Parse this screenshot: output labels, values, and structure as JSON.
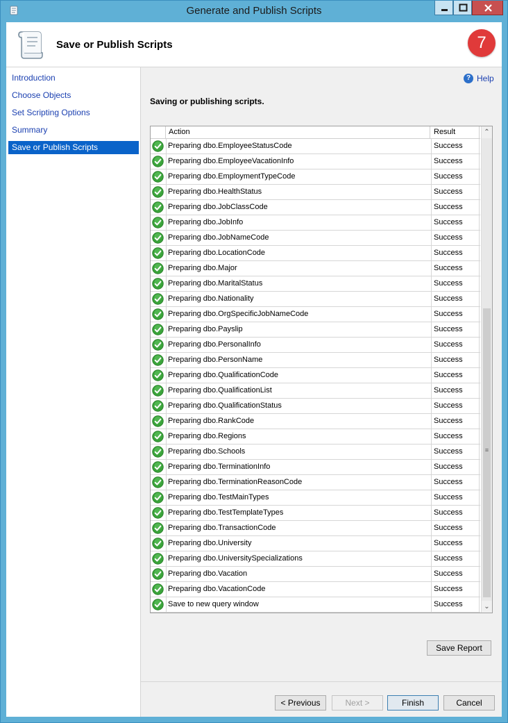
{
  "window": {
    "title": "Generate and Publish Scripts"
  },
  "header": {
    "title": "Save or Publish Scripts",
    "step_badge": "7"
  },
  "sidebar": {
    "items": [
      {
        "label": "Introduction"
      },
      {
        "label": "Choose Objects"
      },
      {
        "label": "Set Scripting Options"
      },
      {
        "label": "Summary"
      },
      {
        "label": "Save or Publish Scripts",
        "selected": true
      }
    ]
  },
  "content": {
    "help_label": "Help",
    "subtitle": "Saving or publishing scripts.",
    "grid": {
      "columns": {
        "action": "Action",
        "result": "Result"
      },
      "rows": [
        {
          "action": "Preparing dbo.EmployeeStatusCode",
          "result": "Success"
        },
        {
          "action": "Preparing dbo.EmployeeVacationInfo",
          "result": "Success"
        },
        {
          "action": "Preparing dbo.EmploymentTypeCode",
          "result": "Success"
        },
        {
          "action": "Preparing dbo.HealthStatus",
          "result": "Success"
        },
        {
          "action": "Preparing dbo.JobClassCode",
          "result": "Success"
        },
        {
          "action": "Preparing dbo.JobInfo",
          "result": "Success"
        },
        {
          "action": "Preparing dbo.JobNameCode",
          "result": "Success"
        },
        {
          "action": "Preparing dbo.LocationCode",
          "result": "Success"
        },
        {
          "action": "Preparing dbo.Major",
          "result": "Success"
        },
        {
          "action": "Preparing dbo.MaritalStatus",
          "result": "Success"
        },
        {
          "action": "Preparing dbo.Nationality",
          "result": "Success"
        },
        {
          "action": "Preparing dbo.OrgSpecificJobNameCode",
          "result": "Success"
        },
        {
          "action": "Preparing dbo.Payslip",
          "result": "Success"
        },
        {
          "action": "Preparing dbo.PersonalInfo",
          "result": "Success"
        },
        {
          "action": "Preparing dbo.PersonName",
          "result": "Success"
        },
        {
          "action": "Preparing dbo.QualificationCode",
          "result": "Success"
        },
        {
          "action": "Preparing dbo.QualificationList",
          "result": "Success"
        },
        {
          "action": "Preparing dbo.QualificationStatus",
          "result": "Success"
        },
        {
          "action": "Preparing dbo.RankCode",
          "result": "Success"
        },
        {
          "action": "Preparing dbo.Regions",
          "result": "Success"
        },
        {
          "action": "Preparing dbo.Schools",
          "result": "Success"
        },
        {
          "action": "Preparing dbo.TerminationInfo",
          "result": "Success"
        },
        {
          "action": "Preparing dbo.TerminationReasonCode",
          "result": "Success"
        },
        {
          "action": "Preparing dbo.TestMainTypes",
          "result": "Success"
        },
        {
          "action": "Preparing dbo.TestTemplateTypes",
          "result": "Success"
        },
        {
          "action": "Preparing dbo.TransactionCode",
          "result": "Success"
        },
        {
          "action": "Preparing dbo.University",
          "result": "Success"
        },
        {
          "action": "Preparing dbo.UniversitySpecializations",
          "result": "Success"
        },
        {
          "action": "Preparing dbo.Vacation",
          "result": "Success"
        },
        {
          "action": "Preparing dbo.VacationCode",
          "result": "Success"
        },
        {
          "action": "Save to new query window",
          "result": "Success"
        }
      ]
    },
    "save_report_label": "Save Report"
  },
  "footer": {
    "previous_label": "< Previous",
    "next_label": "Next >",
    "finish_label": "Finish",
    "cancel_label": "Cancel"
  },
  "colors": {
    "titlebar": "#5fb0d6",
    "selected_nav": "#0a63c9",
    "link": "#1a3fb0",
    "step_badge": "#e03a3a",
    "success_icon": "#3aa33a"
  },
  "icons": {
    "app": "scroll-icon",
    "header": "scroll-icon",
    "row_status": "success-check-icon",
    "help": "help-icon"
  }
}
